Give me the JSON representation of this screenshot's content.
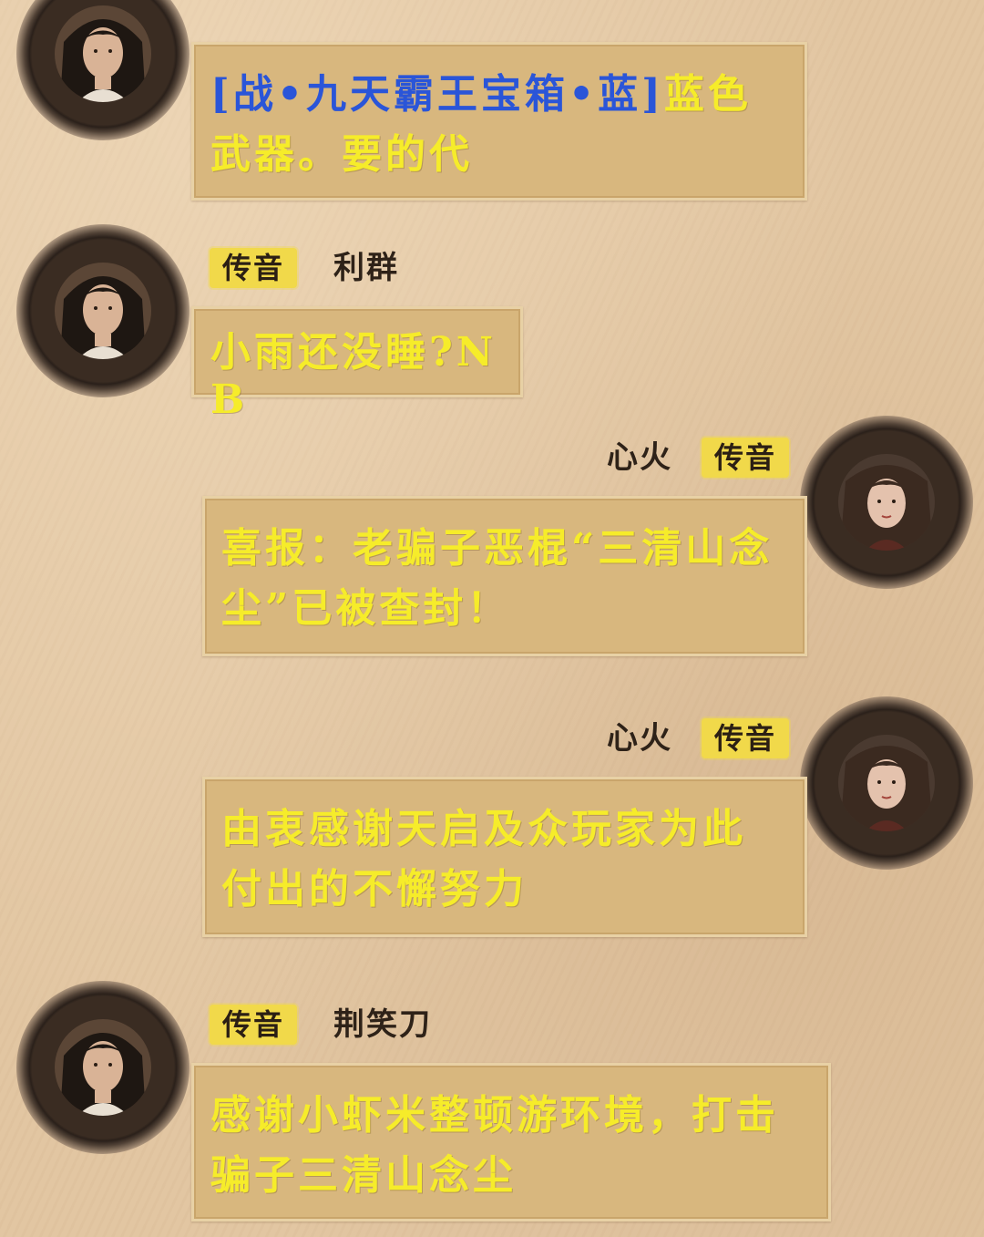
{
  "tag_label": "传音",
  "messages": [
    {
      "id": "m1",
      "side": "left",
      "sender": "",
      "text_parts": [
        {
          "text": "[战•九天霸王宝箱•蓝]",
          "color": "blue"
        },
        {
          "text": "蓝色武器。要的代",
          "color": "yellow"
        }
      ]
    },
    {
      "id": "m2",
      "side": "left",
      "sender": "利群",
      "text": "小雨还没睡?NB"
    },
    {
      "id": "m3",
      "side": "right",
      "sender": "心火",
      "text": "喜报：老骗子恶棍“三清山念尘”已被查封！"
    },
    {
      "id": "m4",
      "side": "right",
      "sender": "心火",
      "text": "由衷感谢天启及众玩家为此付出的不懈努力"
    },
    {
      "id": "m5",
      "side": "left",
      "sender": "荆笑刀",
      "text": "感谢小虾米整顿游环境，打击骗子三清山念尘"
    }
  ],
  "colors": {
    "accent_yellow": "#f1d94a",
    "message_text": "#f6ec2a",
    "item_link": "#2a55d8",
    "bubble": "#d8b77e",
    "paper": "#e2c6a2"
  },
  "icons": {
    "male_avatar": "male-avatar-icon",
    "female_avatar": "female-avatar-icon"
  }
}
